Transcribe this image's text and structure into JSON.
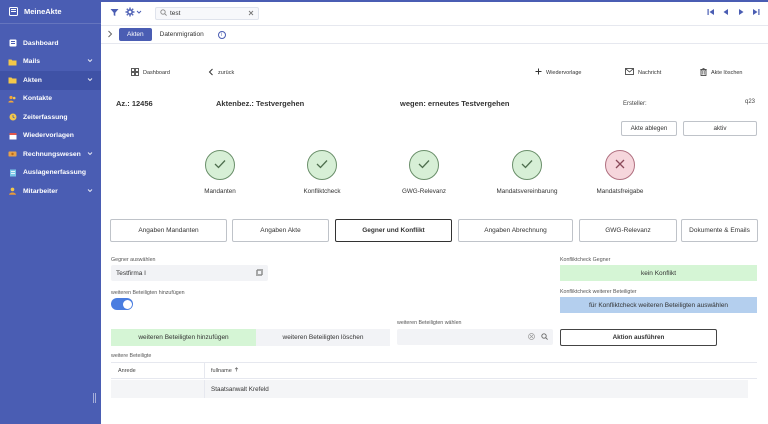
{
  "app": {
    "title": "MeineAkte"
  },
  "sidebar": {
    "items": [
      {
        "label": "Dashboard",
        "icon": "dashboard-icon",
        "chevron": false
      },
      {
        "label": "Mails",
        "icon": "mail-folder-icon",
        "chevron": true
      },
      {
        "label": "Akten",
        "icon": "folder-icon",
        "chevron": true,
        "active": true
      },
      {
        "label": "Kontakte",
        "icon": "contacts-icon",
        "chevron": false
      },
      {
        "label": "Zeiterfassung",
        "icon": "clock-icon",
        "chevron": false
      },
      {
        "label": "Wiedervorlagen",
        "icon": "calendar-icon",
        "chevron": false
      },
      {
        "label": "Rechnungswesen",
        "icon": "invoice-icon",
        "chevron": true
      },
      {
        "label": "Auslagenerfassung",
        "icon": "expenses-icon",
        "chevron": false
      },
      {
        "label": "Mitarbeiter",
        "icon": "employee-icon",
        "chevron": true
      }
    ]
  },
  "topbar": {
    "search_value": "test"
  },
  "tabs": {
    "items": [
      "Akten",
      "Datenmigration"
    ]
  },
  "toolbar": {
    "dashboard": "Dashboard",
    "back": "zurück",
    "wiedervorlage": "Wiedervorlage",
    "nachricht": "Nachricht",
    "delete": "Akte löschen"
  },
  "header": {
    "az": "Az.: 12456",
    "aktenbez": "Aktenbez.: Testvergehen",
    "wegen": "wegen: erneutes Testvergehen",
    "ersteller_label": "Ersteller:",
    "ersteller_value": "q23",
    "btn_ablegen": "Akte ablegen",
    "btn_aktiv": "aktiv"
  },
  "statuses": [
    {
      "label": "Mandanten",
      "state": "ok"
    },
    {
      "label": "Konfliktcheck",
      "state": "ok"
    },
    {
      "label": "GWG-Relevanz",
      "state": "ok"
    },
    {
      "label": "Mandatsvereinbarung",
      "state": "ok"
    },
    {
      "label": "Mandatsfreigabe",
      "state": "bad"
    }
  ],
  "sections": [
    "Angaben Mandanten",
    "Angaben Akte",
    "Gegner und Konflikt",
    "Angaben Abrechnung",
    "GWG-Relevanz",
    "Dokumente & Emails"
  ],
  "form": {
    "gegner_label": "Gegner auswählen",
    "gegner_value": "Testfirma I",
    "weitere_toggle_label": "weiteren Beteiligten hinzufügen",
    "btn_add": "weiteren Beteiligten hinzufügen",
    "btn_del": "weiteren Beteiligten löschen",
    "weitere_waehlen_label": "weiteren Beteiligten wählen",
    "btn_action": "Aktion ausführen",
    "konflikt_label": "Konfliktcheck Gegner",
    "konflikt_value": "kein Konflikt",
    "konflikt_weitere_label": "Konfliktcheck weiterer Beteiligter",
    "konflikt_weitere_value": "für Konfliktcheck weiteren Beteiligten auswählen"
  },
  "table": {
    "title": "weitere Beteiligte",
    "columns": [
      "Anrede",
      "fullname"
    ],
    "rows": [
      {
        "anrede": "",
        "fullname": "Staatsanwalt Krefeld"
      }
    ]
  }
}
